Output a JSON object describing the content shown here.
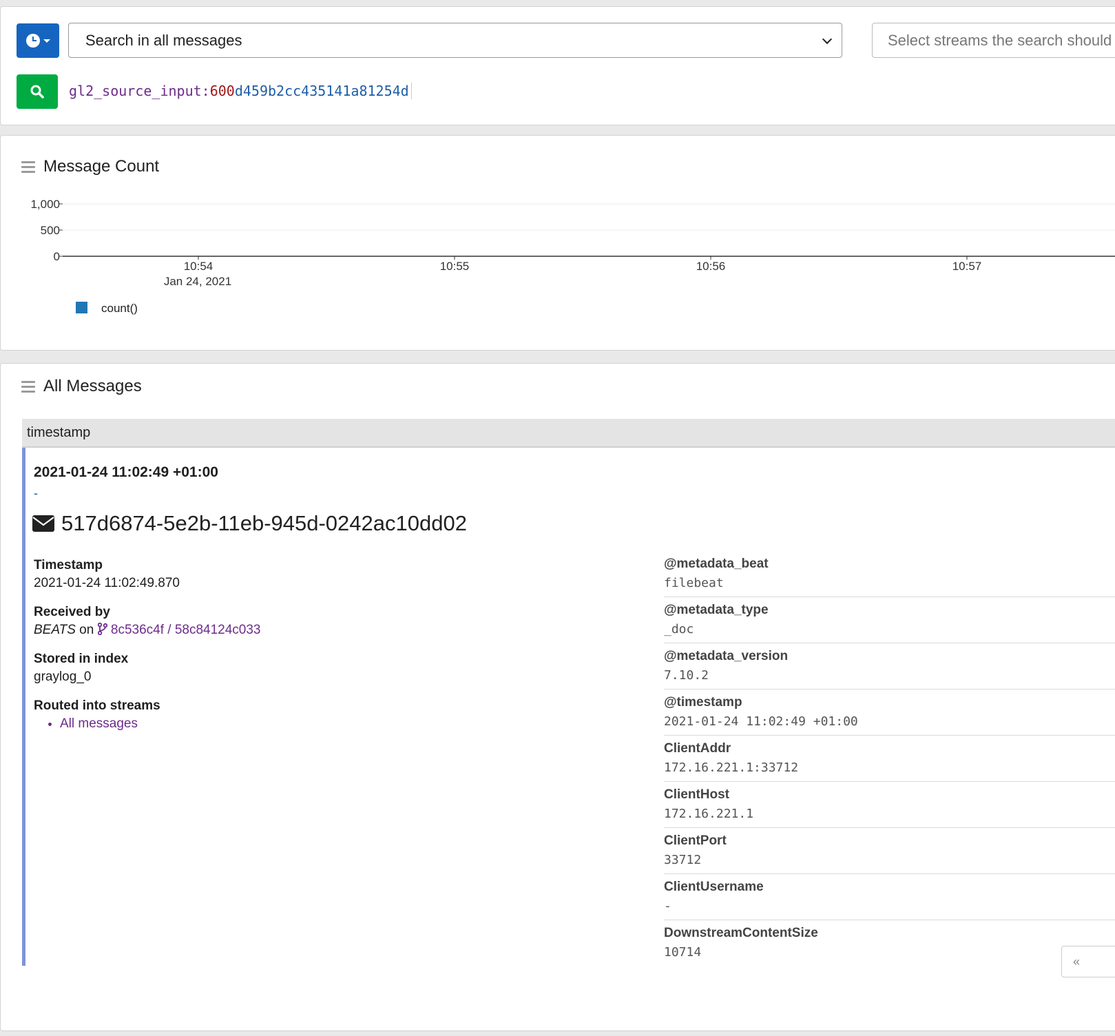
{
  "search": {
    "scope_selected": "Search in all messages",
    "streams_placeholder": "Select streams the search should include",
    "query": {
      "key": "gl2_source_input:",
      "num": "600",
      "rest": "d459b2cc435141a81254d"
    }
  },
  "message_count": {
    "title": "Message Count"
  },
  "chart_data": {
    "type": "bar",
    "title": "Message Count",
    "yticks": [
      "1,000",
      "500",
      "0"
    ],
    "ylim": [
      0,
      1000
    ],
    "x_ticks": [
      {
        "label": "10:54",
        "sub": "Jan 24, 2021"
      },
      {
        "label": "10:55",
        "sub": ""
      },
      {
        "label": "10:56",
        "sub": ""
      },
      {
        "label": "10:57",
        "sub": ""
      }
    ],
    "series": [
      {
        "name": "count()",
        "color": "#1f77b4",
        "values": [
          0,
          0,
          0,
          0
        ]
      }
    ],
    "legend": "bottom-left",
    "grid": true
  },
  "messages": {
    "title": "All Messages",
    "column_header": "timestamp",
    "message": {
      "timestamp_display": "2021-01-24 11:02:49 +01:00",
      "dash": "-",
      "id": "517d6874-5e2b-11eb-945d-0242ac10dd02",
      "timestamp_label": "Timestamp",
      "timestamp_value": "2021-01-24 11:02:49.870",
      "received_label": "Received by",
      "received_input": "BEATS",
      "received_on": "on",
      "received_node": "8c536c4f / 58c84124c033",
      "index_label": "Stored in index",
      "index_value": "graylog_0",
      "streams_label": "Routed into streams",
      "streams": [
        "All messages"
      ],
      "fields": [
        {
          "name": "@metadata_beat",
          "value": "filebeat"
        },
        {
          "name": "@metadata_type",
          "value": "_doc"
        },
        {
          "name": "@metadata_version",
          "value": "7.10.2"
        },
        {
          "name": "@timestamp",
          "value": "2021-01-24 11:02:49 +01:00"
        },
        {
          "name": "ClientAddr",
          "value": "172.16.221.1:33712"
        },
        {
          "name": "ClientHost",
          "value": "172.16.221.1"
        },
        {
          "name": "ClientPort",
          "value": "33712"
        },
        {
          "name": "ClientUsername",
          "value": "-"
        },
        {
          "name": "DownstreamContentSize",
          "value": "10714"
        }
      ]
    },
    "collapse_glyph": "«"
  }
}
